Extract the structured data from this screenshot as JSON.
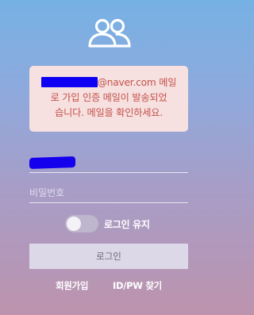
{
  "logo": {
    "icon": "users-icon",
    "color": "#ffffff"
  },
  "notice": {
    "email_domain": "@naver.com",
    "message_part1": " 메일",
    "message_line2": "로 가입 인증 메일이 발송되었",
    "message_line3": "습니다. 메일을 확인하세요."
  },
  "form": {
    "password_placeholder": "비밀번호",
    "keep_login_label": "로그인 유지",
    "keep_login_checked": false,
    "login_button_label": "로그인"
  },
  "links": {
    "signup": "회원가입",
    "find": "ID/PW 찾기"
  },
  "colors": {
    "notice_bg": "#f6e0e0",
    "notice_text": "#c4534b",
    "redaction": "#1500ee",
    "button_bg": "#ddd8e8"
  }
}
